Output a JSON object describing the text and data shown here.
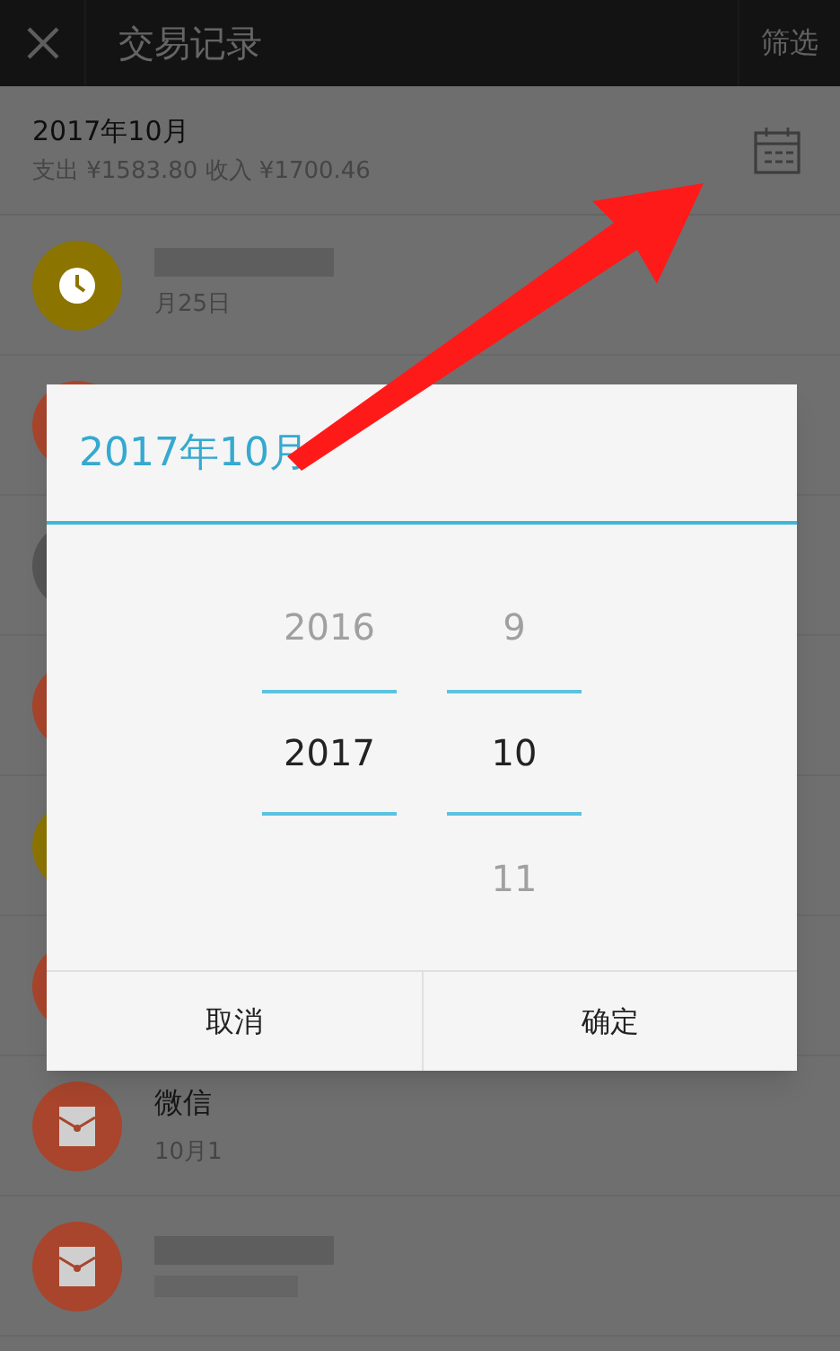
{
  "header": {
    "title": "交易记录",
    "action": "筛选"
  },
  "summary": {
    "month": "2017年10月",
    "totals": "支出 ¥1583.80 收入 ¥1700.46"
  },
  "records": [
    {
      "color": "#8c7400",
      "kind": "clock",
      "date": "月25日"
    },
    {
      "color": "#a8452c",
      "kind": "plain"
    },
    {
      "color": "#555555",
      "kind": "plain"
    },
    {
      "color": "#a8452c",
      "kind": "plain"
    },
    {
      "color": "#8c7400",
      "kind": "plain"
    },
    {
      "color": "#a8452c",
      "kind": "plain"
    },
    {
      "color": "#a8452c",
      "kind": "envelope",
      "title": "微信",
      "date": "10月1"
    },
    {
      "color": "#a8452c",
      "kind": "envelope"
    }
  ],
  "dialog": {
    "title": "2017年10月",
    "columns": [
      {
        "items": [
          {
            "label": "2016",
            "selected": false
          },
          {
            "label": "2017",
            "selected": true
          }
        ]
      },
      {
        "items": [
          {
            "label": "9",
            "selected": false
          },
          {
            "label": "10",
            "selected": true
          },
          {
            "label": "11",
            "selected": false
          }
        ]
      }
    ],
    "buttons": [
      "取消",
      "确定"
    ]
  }
}
